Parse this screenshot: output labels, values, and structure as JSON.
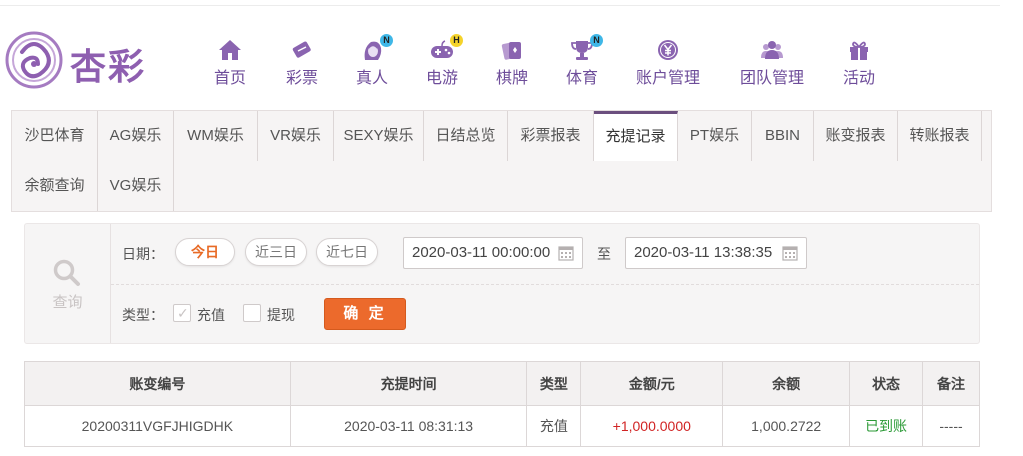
{
  "brand": {
    "logo_text": "杏彩",
    "accent": "#8e5fb0"
  },
  "nav": {
    "items": [
      {
        "label": "首页",
        "icon": "home-icon"
      },
      {
        "label": "彩票",
        "icon": "lottery-ticket-icon"
      },
      {
        "label": "真人",
        "icon": "live-dealer-icon",
        "badge": "N"
      },
      {
        "label": "电游",
        "icon": "gamepad-icon",
        "badge": "H"
      },
      {
        "label": "棋牌",
        "icon": "playing-cards-icon"
      },
      {
        "label": "体育",
        "icon": "trophy-icon",
        "badge": "N"
      },
      {
        "label": "账户管理",
        "icon": "yen-coin-icon"
      },
      {
        "label": "团队管理",
        "icon": "team-icon"
      },
      {
        "label": "活动",
        "icon": "gift-icon"
      }
    ]
  },
  "tabs": [
    {
      "label": "沙巴体育"
    },
    {
      "label": "AG娱乐"
    },
    {
      "label": "WM娱乐"
    },
    {
      "label": "VR娱乐"
    },
    {
      "label": "SEXY娱乐"
    },
    {
      "label": "日结总览"
    },
    {
      "label": "彩票报表"
    },
    {
      "label": "充提记录",
      "active": true
    },
    {
      "label": "PT娱乐"
    },
    {
      "label": "BBIN"
    },
    {
      "label": "账变报表"
    },
    {
      "label": "转账报表"
    },
    {
      "label": "余额查询"
    },
    {
      "label": "VG娱乐"
    }
  ],
  "filter": {
    "query_label": "查询",
    "date_label": "日期：",
    "quick_ranges": [
      "今日",
      "近三日",
      "近七日"
    ],
    "active_range": "今日",
    "start_datetime": "2020-03-11 00:00:00",
    "to_label": "至",
    "end_datetime": "2020-03-11 13:38:35",
    "type_label": "类型：",
    "types": [
      {
        "label": "充值",
        "checked": true
      },
      {
        "label": "提现",
        "checked": false
      }
    ],
    "confirm_label": "确 定"
  },
  "table": {
    "columns": [
      "账变编号",
      "充提时间",
      "类型",
      "金额/元",
      "余额",
      "状态",
      "备注"
    ],
    "rows": [
      {
        "id": "20200311VGFJHIGDHK",
        "time": "2020-03-11 08:31:13",
        "type": "充值",
        "amount": "+1,000.0000",
        "balance": "1,000.2722",
        "status": "已到账",
        "remark": "-----"
      }
    ]
  },
  "colors": {
    "amount_positive": "#d12424",
    "status_success": "#2b9a36",
    "confirm_button": "#ec6a2c",
    "active_range": "#e86a25",
    "nav_text": "#6e4d9a"
  }
}
